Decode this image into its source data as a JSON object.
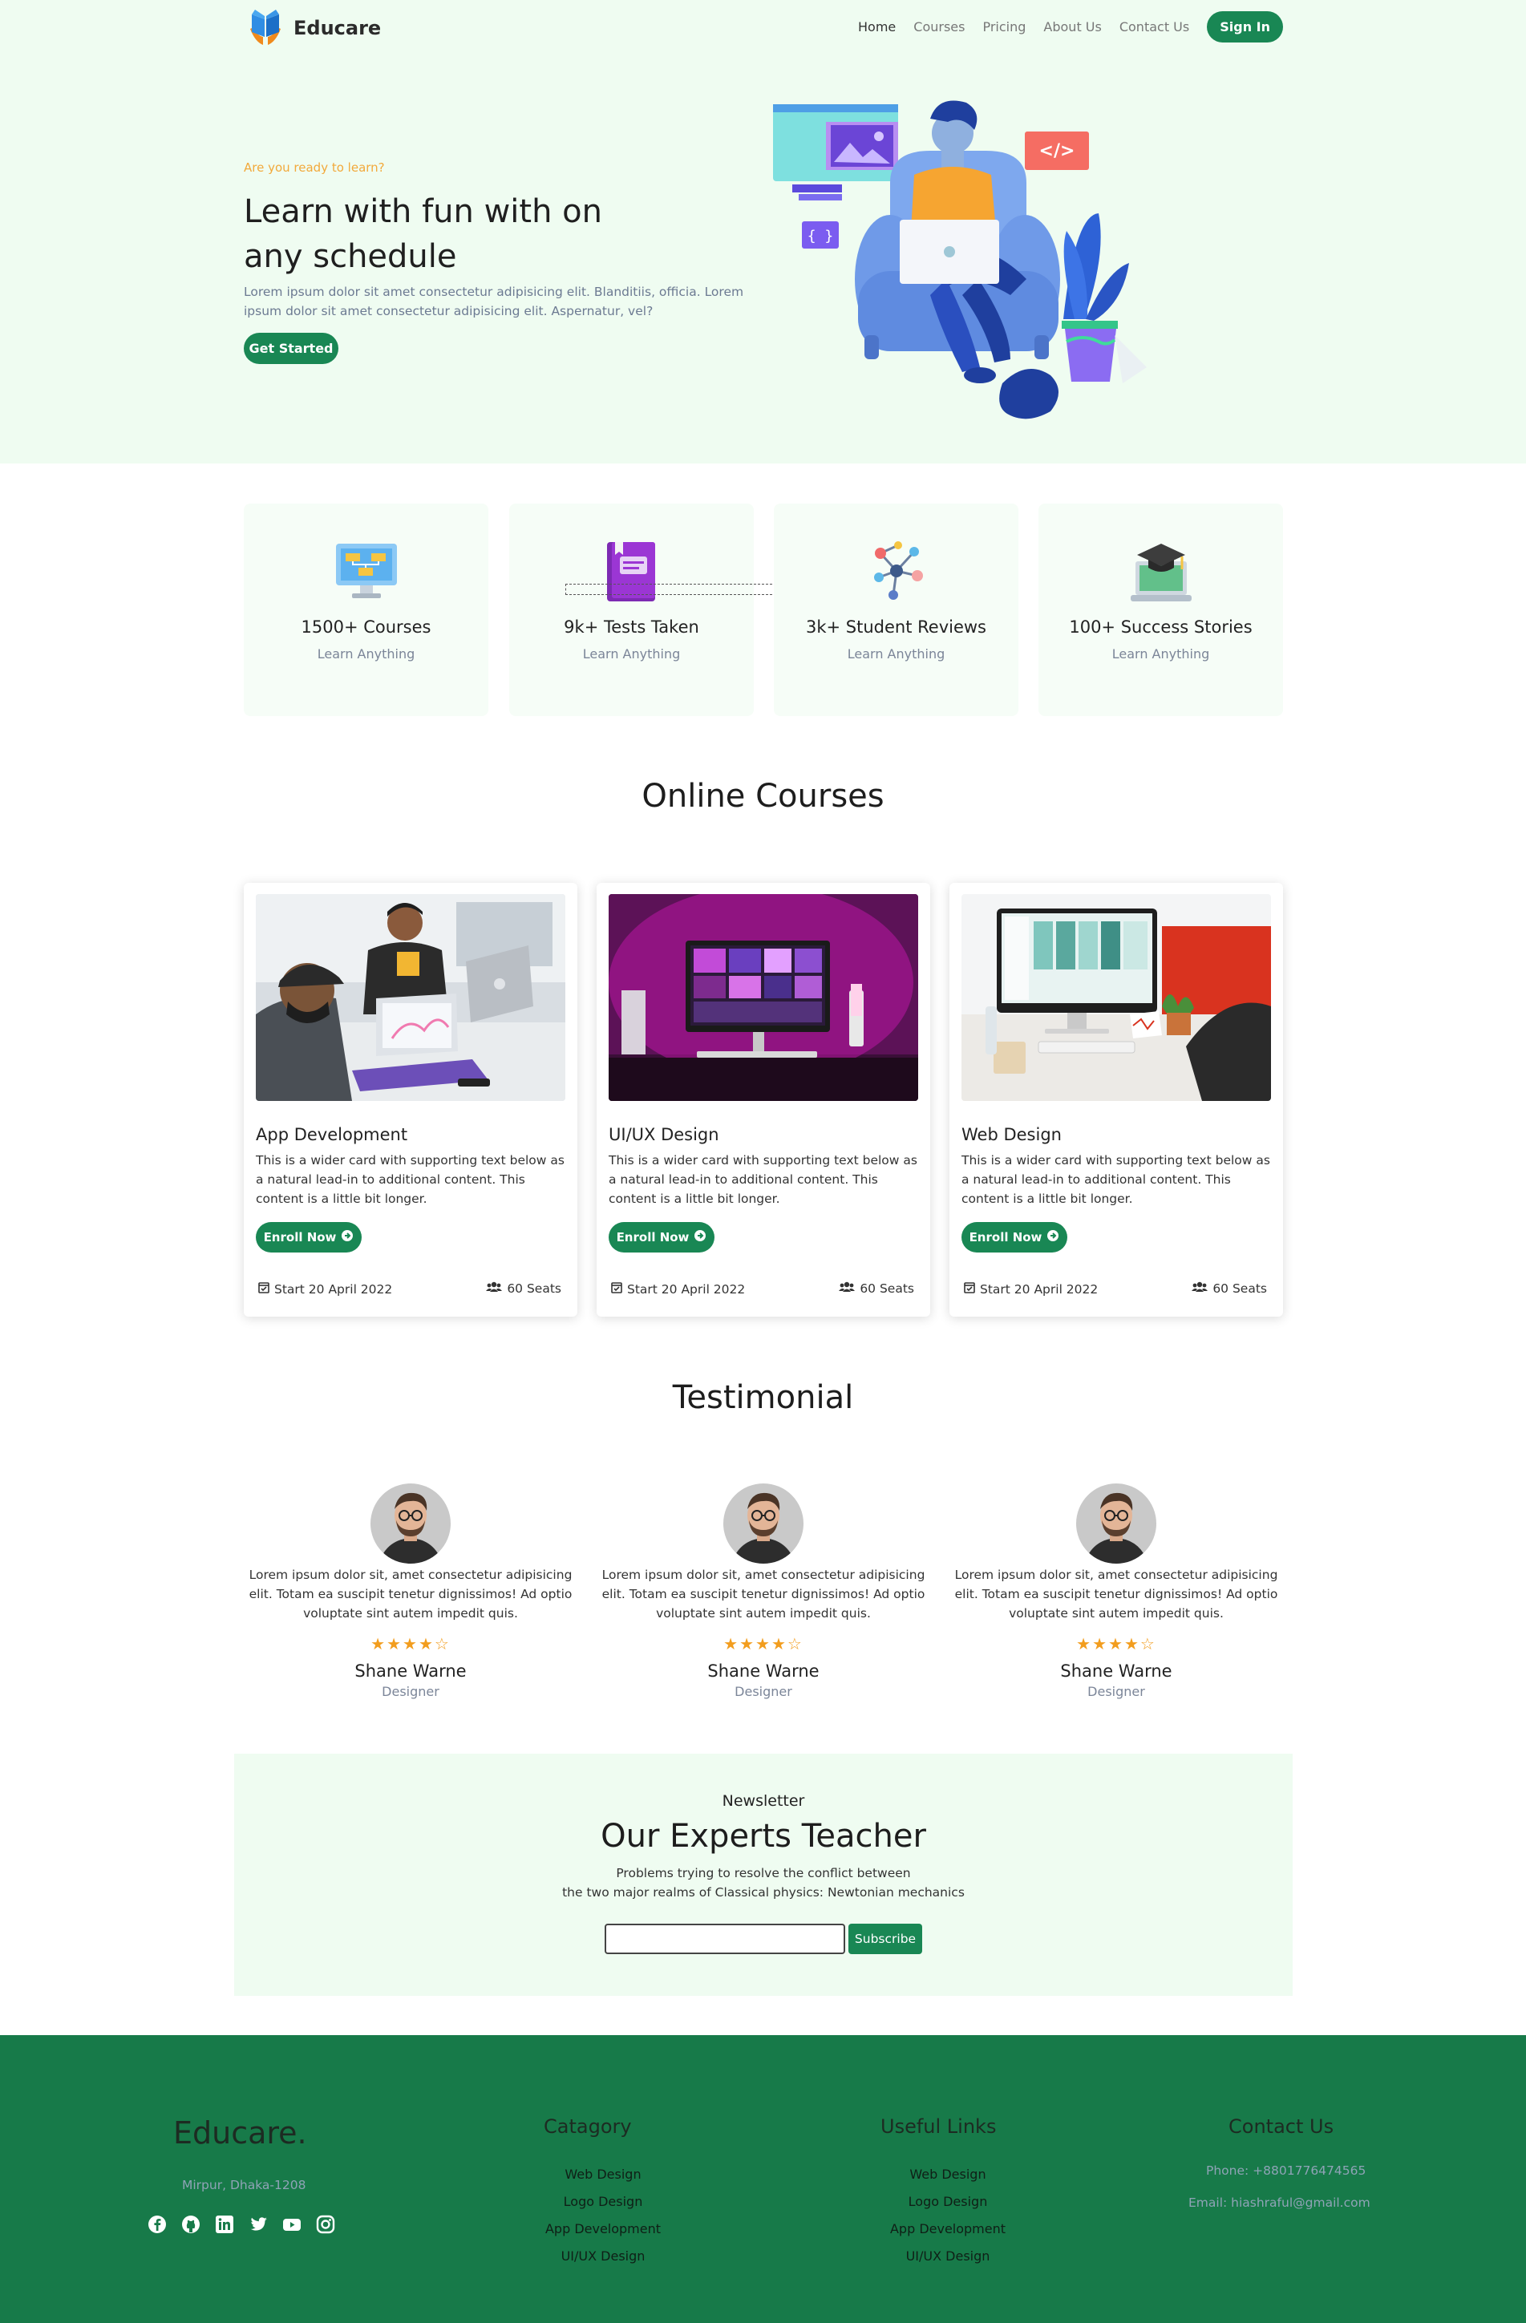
{
  "nav": {
    "brand": "Educare",
    "links": [
      "Home",
      "Courses",
      "Pricing",
      "About Us",
      "Contact Us"
    ],
    "sign_in": "Sign In"
  },
  "hero": {
    "tag": "Are you ready to learn?",
    "title": "Learn with fun with on any schedule",
    "text": "Lorem ipsum dolor sit amet consectetur adipisicing elit. Blanditiis, officia. Lorem ipsum dolor sit amet consectetur adipisicing elit. Aspernatur, vel?",
    "button": "Get Started"
  },
  "stats": [
    {
      "title": "1500+ Courses",
      "sub": "Learn Anything",
      "icon": "flowchart-monitor-icon"
    },
    {
      "title": "9k+ Tests Taken",
      "sub": "Learn Anything",
      "icon": "book-icon"
    },
    {
      "title": "3k+ Student Reviews",
      "sub": "Learn Anything",
      "icon": "network-icon"
    },
    {
      "title": "100+ Success Stories",
      "sub": "Learn Anything",
      "icon": "graduation-laptop-icon"
    }
  ],
  "courses_section": {
    "title": "Online Courses",
    "cards": [
      {
        "title": "App Development",
        "text": "This is a wider card with supporting text below as a natural lead-in to additional content. This content is a little bit longer.",
        "button": "Enroll Now",
        "date": "Start 20 April 2022",
        "seats": "60 Seats"
      },
      {
        "title": "UI/UX Design",
        "text": "This is a wider card with supporting text below as a natural lead-in to additional content. This content is a little bit longer.",
        "button": "Enroll Now",
        "date": "Start 20 April 2022",
        "seats": "60 Seats"
      },
      {
        "title": "Web Design",
        "text": "This is a wider card with supporting text below as a natural lead-in to additional content. This content is a little bit longer.",
        "button": "Enroll Now",
        "date": "Start 20 April 2022",
        "seats": "60 Seats"
      }
    ]
  },
  "testimonial_section": {
    "title": "Testimonial",
    "items": [
      {
        "text": "Lorem ipsum dolor sit, amet consectetur adipisicing elit. Totam ea suscipit tenetur dignissimos! Ad optio voluptate sint autem impedit quis.",
        "rating": 4,
        "max_rating": 5,
        "name": "Shane Warne",
        "role": "Designer"
      },
      {
        "text": "Lorem ipsum dolor sit, amet consectetur adipisicing elit. Totam ea suscipit tenetur dignissimos! Ad optio voluptate sint autem impedit quis.",
        "rating": 4,
        "max_rating": 5,
        "name": "Shane Warne",
        "role": "Designer"
      },
      {
        "text": "Lorem ipsum dolor sit, amet consectetur adipisicing elit. Totam ea suscipit tenetur dignissimos! Ad optio voluptate sint autem impedit quis.",
        "rating": 4,
        "max_rating": 5,
        "name": "Shane Warne",
        "role": "Designer"
      }
    ]
  },
  "newsletter": {
    "kicker": "Newsletter",
    "title": "Our Experts Teacher",
    "line1": "Problems trying to resolve the conflict between",
    "line2": "the two major realms of Classical physics: Newtonian mechanics",
    "input_value": "",
    "button": "Subscribe"
  },
  "footer": {
    "brand": "Educare.",
    "address": "Mirpur, Dhaka-1208",
    "social_icons": [
      "facebook-icon",
      "github-icon",
      "linkedin-icon",
      "twitter-icon",
      "youtube-icon",
      "instagram-icon"
    ],
    "category_title": "Catagory",
    "category_links": [
      "Web Design",
      "Logo Design",
      "App Development",
      "UI/UX Design"
    ],
    "useful_title": "Useful Links",
    "useful_links": [
      "Web Design",
      "Logo Design",
      "App Development",
      "UI/UX Design"
    ],
    "contact_title": "Contact Us",
    "phone": "Phone: +8801776474565",
    "email": "Email: hiashraful@gmail.com"
  },
  "colors": {
    "primary": "#198754",
    "hero_bg": "#effcf1",
    "footer_bg": "#177a49",
    "accent": "#f2a93b",
    "star": "#f29d1e"
  }
}
